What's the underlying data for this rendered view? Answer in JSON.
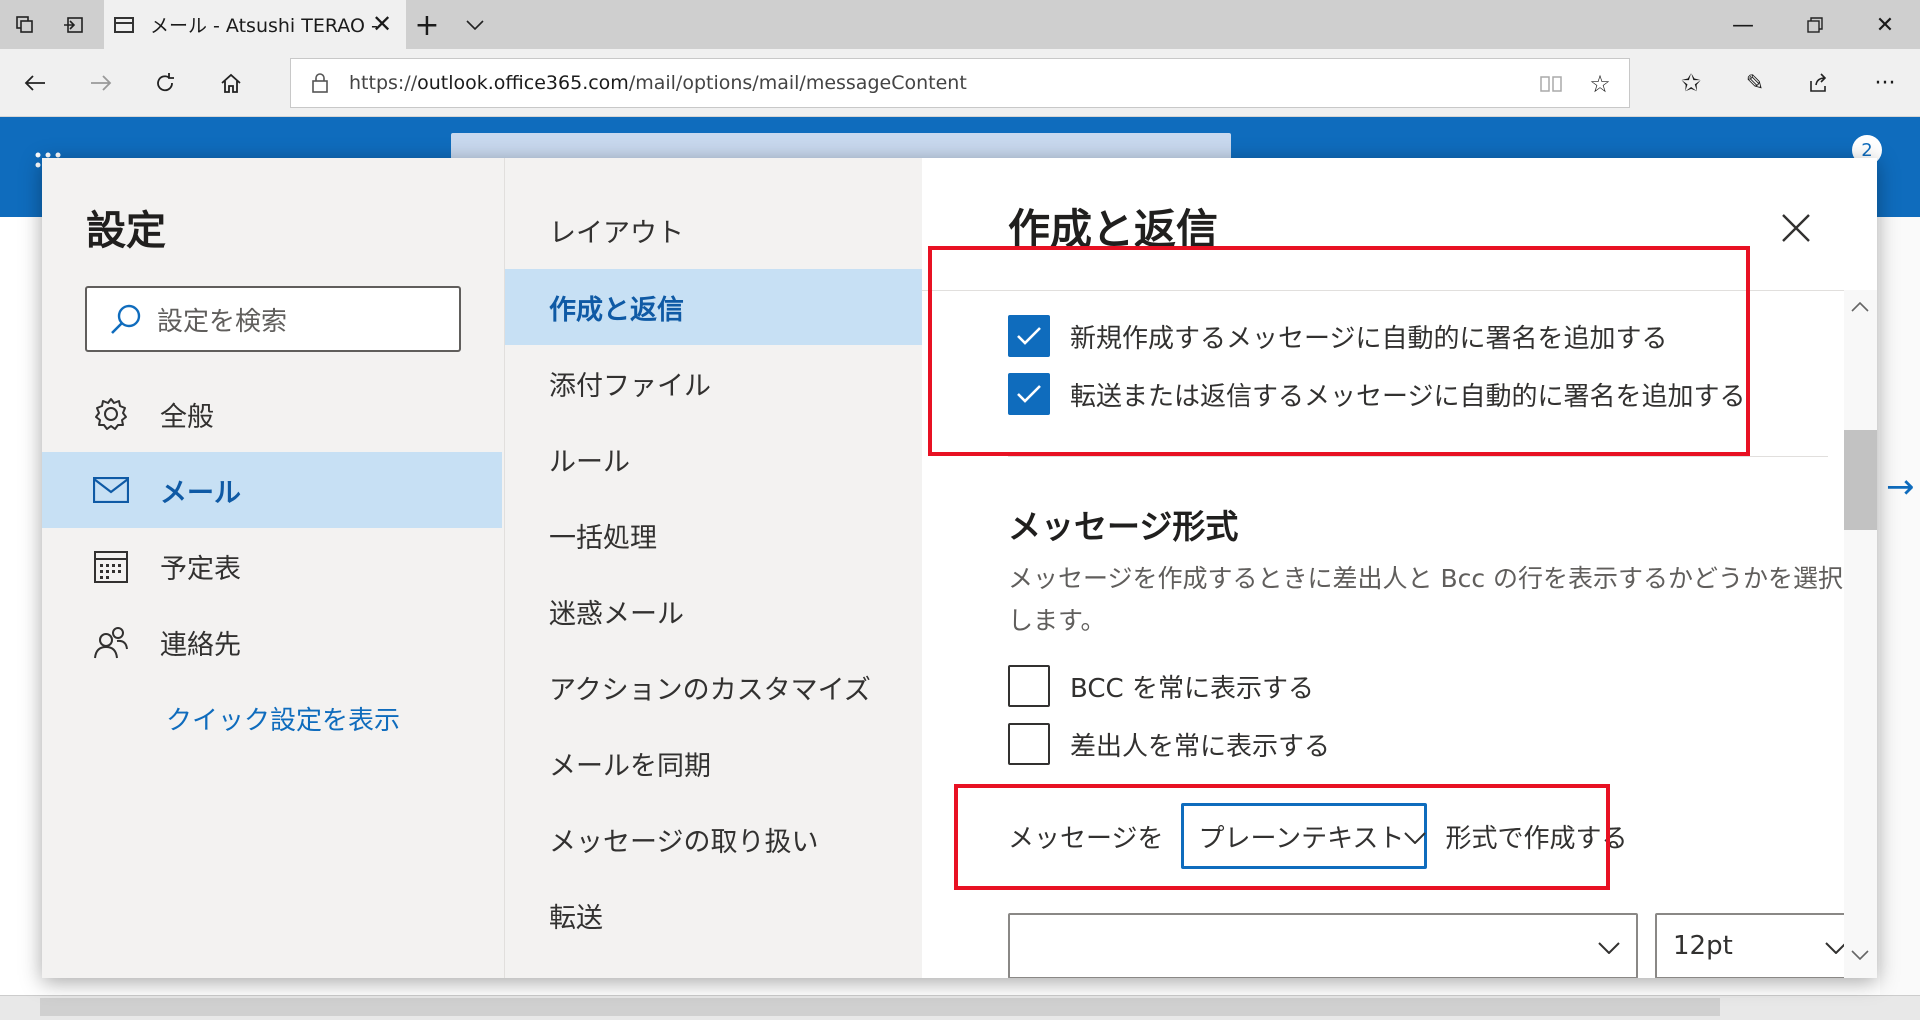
{
  "browser": {
    "tab_title": "メール - Atsushi TERAO -",
    "url_prefix": "https://",
    "url_host": "outlook.office365.com",
    "url_path": "/mail/options/mail/messageContent"
  },
  "outlook_header": {
    "notification_count": "2"
  },
  "settings": {
    "title": "設定",
    "search_placeholder": "設定を検索",
    "categories": [
      {
        "label": "全般",
        "icon": "gear-icon"
      },
      {
        "label": "メール",
        "icon": "mail-icon",
        "active": true
      },
      {
        "label": "予定表",
        "icon": "calendar-icon"
      },
      {
        "label": "連絡先",
        "icon": "people-icon"
      }
    ],
    "quick_settings_link": "クイック設定を表示"
  },
  "mail_nav": {
    "items": [
      "レイアウト",
      "作成と返信",
      "添付ファイル",
      "ルール",
      "一括処理",
      "迷惑メール",
      "アクションのカスタマイズ",
      "メールを同期",
      "メッセージの取り扱い",
      "転送"
    ],
    "active_index": 1
  },
  "pane": {
    "title": "作成と返信",
    "signature_options": [
      {
        "label": "新規作成するメッセージに自動的に署名を追加する",
        "checked": true
      },
      {
        "label": "転送または返信するメッセージに自動的に署名を追加する",
        "checked": true
      }
    ],
    "message_format": {
      "title": "メッセージ形式",
      "description": "メッセージを作成するときに差出人と Bcc の行を表示するかどうかを選択します。",
      "options": [
        {
          "label": "BCC を常に表示する",
          "checked": false
        },
        {
          "label": "差出人を常に表示する",
          "checked": false
        }
      ],
      "compose_prefix": "メッセージを",
      "compose_format_value": "プレーンテキスト",
      "compose_suffix": "形式で作成する",
      "font_value": "",
      "font_size_value": "12pt"
    }
  },
  "colors": {
    "accent": "#0f6cbd",
    "highlight": "#c7e0f4",
    "annotation_red": "#e81123"
  }
}
